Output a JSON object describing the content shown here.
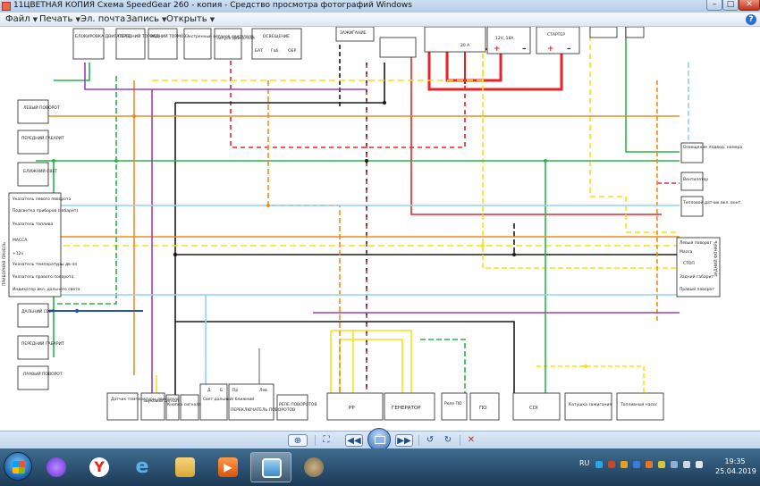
{
  "window": {
    "title": "11ЦВЕТНАЯ КОПИЯ Схема SpeedGear 260 - копия - Средство просмотра фотографий Windows",
    "minimize_label": "–",
    "maximize_label": "□",
    "close_label": "✕"
  },
  "menu": {
    "items": [
      {
        "label": "Файл",
        "has_caret": true
      },
      {
        "label": "Печать",
        "has_caret": true
      },
      {
        "label": "Эл. почта",
        "has_caret": false
      },
      {
        "label": "Запись",
        "has_caret": true
      },
      {
        "label": "Открыть",
        "has_caret": true
      }
    ],
    "help_label": "?"
  },
  "diagram": {
    "top_boxes": [
      "БЛОКИРОВКА ДВИГАТЕЛЯ",
      "ПЕРЕДНИЙ ТОРМОЗ",
      "ЗАДНИЙ ТОРМОЗ",
      "Экстренный останов двигателя",
      "Запуск двигателя",
      "ОСВЕЩЕНИЕ",
      "ЗАЖИГАНИЕ",
      "12V, 18A",
      "СТАРТЕР",
      "20 А"
    ],
    "lighting_sub": [
      "БАТ",
      "Габ.",
      "ОБР"
    ],
    "left_boxes": [
      "ЛЕВЫЙ ПОВОРОТ",
      "ПЕРЕДНИЙ ГАБАРИТ",
      "БЛИЖНИЙ СВЕТ",
      "ДАЛЬНИЙ СВЕТ",
      "ПЕРЕДНИЙ ГАБАРИТ",
      "ПРАВЫЙ ПОВОРОТ"
    ],
    "panel_label": "ПРИБОРНАЯ ПАНЕЛЬ",
    "panel_rows": [
      "Указатель левого поворота",
      "Подсветка приборов (габарит)",
      "Указатель топлива",
      "МАССА",
      "+12v",
      "Указатель температуры дв-ля",
      "Указатель правого поворота",
      "Индикатор вкл. дальнего света"
    ],
    "right_boxes": [
      "Освещение подвод. номера",
      "Вентилятор",
      "Тепловой датчик вкл. вент."
    ],
    "rear_label": "ЗАДНИЙ ФОНАРЬ",
    "rear_rows": [
      "Левый поворот",
      "Масса",
      "СТОП",
      "Задний габарит",
      "Правый поворот"
    ],
    "bottom_boxes": [
      "Датчик температуры двигателя",
      "Звуковой сигнал",
      "Кнопка сигнала",
      "Свет дальний/ ближний",
      "ПЕРЕКЛЮЧАТЕЛЬ ПОВОРОТОВ",
      "РЕЛЕ ПОВОРОТОВ",
      "РР",
      "ГЕНЕРАТОР",
      "Реле ПО",
      "ПО",
      "CDI",
      "Катушка зажигания",
      "Топливный насос"
    ],
    "switch_labels": [
      "Д",
      "Б",
      "Пр",
      "Лев"
    ],
    "wire_colors": {
      "red": "#e8232a",
      "black": "#1a1a1a",
      "yellow": "#f5e11a",
      "green": "#2db24a",
      "orange": "#f08a24",
      "purple": "#9b3fb5",
      "light_blue": "#8fd3f0",
      "blue": "#2a4fb5",
      "brown": "#a0522d",
      "gray": "#9a9a9a"
    }
  },
  "viewer_toolbar": {
    "zoom_icon": "magnifier-icon",
    "buttons": [
      "fit-icon",
      "previous-icon",
      "slideshow-icon",
      "next-icon",
      "rotate-left-icon",
      "rotate-right-icon",
      "delete-icon"
    ]
  },
  "taskbar": {
    "apps": [
      "alice-icon",
      "yandex-browser-icon",
      "internet-explorer-icon",
      "file-explorer-icon",
      "media-player-icon",
      "photo-viewer-icon",
      "gimp-icon"
    ],
    "language": "RU",
    "time": "19:35",
    "date": "25.04.2019"
  }
}
